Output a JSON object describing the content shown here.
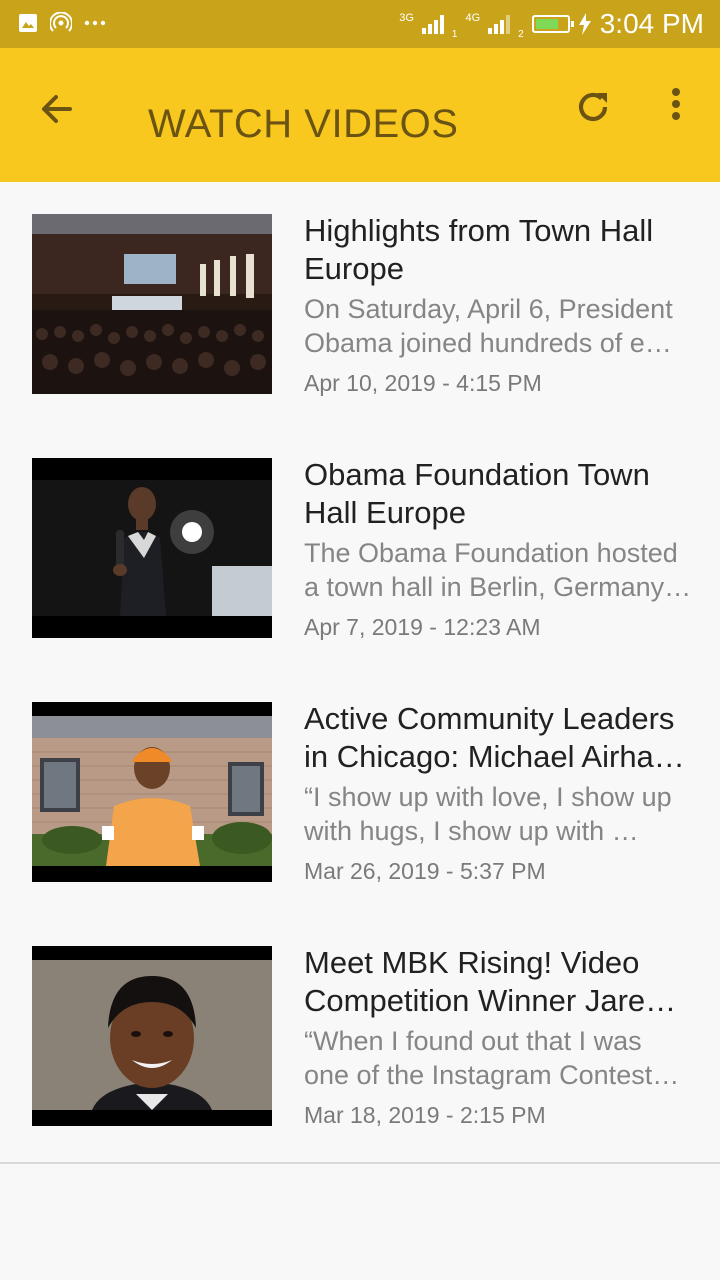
{
  "status_bar": {
    "time": "3:04 PM",
    "network_1": "3G",
    "network_2": "4G",
    "sim_1": "1",
    "sim_2": "2",
    "battery_level": 0.75
  },
  "app_bar": {
    "title": "WATCH VIDEOS",
    "back_icon": "arrow-back-icon",
    "refresh_icon": "refresh-icon",
    "more_icon": "more-vert-icon"
  },
  "videos": [
    {
      "title": "Highlights from Town Hall Europe",
      "description": "On Saturday, April 6, President Obama joined hundreds of e…",
      "date": "Apr 10, 2019 - 4:15 PM"
    },
    {
      "title": "Obama Foundation Town Hall Europe",
      "description": "The Obama Foundation hosted a town hall in Berlin, Germany…",
      "date": "Apr 7, 2019 - 12:23 AM"
    },
    {
      "title": "Active Community Leaders in Chicago: Michael Airha…",
      "description": "“I show up with love, I show up with hugs, I show up with …",
      "date": "Mar 26, 2019 - 5:37 PM"
    },
    {
      "title": "Meet MBK Rising! Video Competition Winner Jare…",
      "description": "“When I found out that I was one of the Instagram Contest…",
      "date": "Mar 18, 2019 - 2:15 PM"
    }
  ]
}
